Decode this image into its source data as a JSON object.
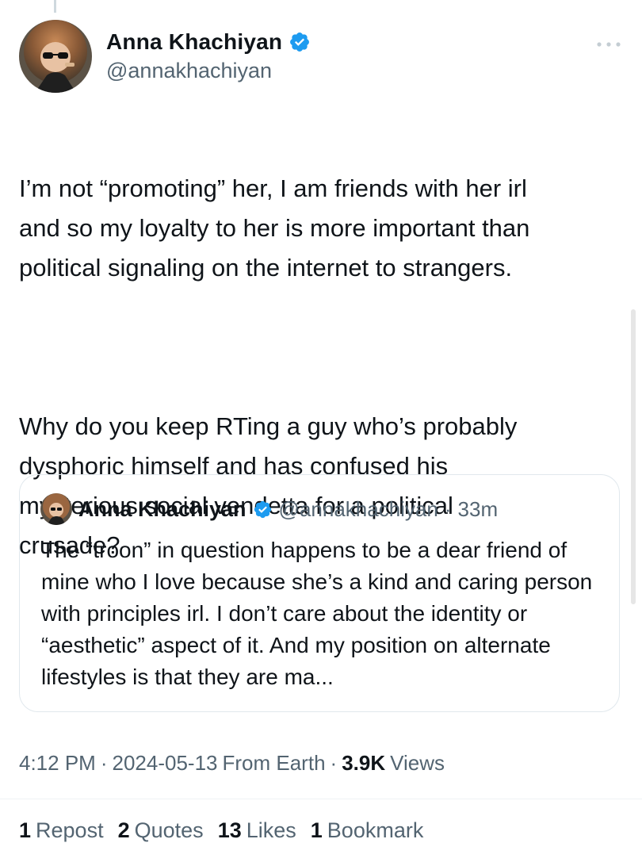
{
  "tweet": {
    "author": {
      "display_name": "Anna Khachiyan",
      "handle": "@annakhachiyan",
      "verified": true
    },
    "paragraph_1": "I’m not “promoting” her, I am friends with her irl\nand so my loyalty to her is more important than\npolitical signaling on the internet to strangers.",
    "paragraph_2": "Why do you keep RTing a guy who’s probably\ndysphoric himself and has confused his\nmysterious social vendetta for a political\ncrusade?",
    "more_icon": "more-horizontal-icon"
  },
  "quote": {
    "display_name": "Anna Khachiyan",
    "handle": "@annakhachiyan",
    "dot": "·",
    "time": "33m",
    "text": "The “troon” in question happens to be a dear friend of mine who I love because she’s a kind and caring person with principles irl. I don’t care about the identity or “aesthetic” aspect of it. And my position on alternate lifestyles is that they are ma..."
  },
  "meta": {
    "time": "4:12 PM",
    "sep1": "·",
    "date": "2024-05-13",
    "source": "From Earth",
    "sep2": "·",
    "views_count": "3.9K",
    "views_label": "Views"
  },
  "stats": {
    "reposts_count": "1",
    "reposts_label": "Repost",
    "quotes_count": "2",
    "quotes_label": "Quotes",
    "likes_count": "13",
    "likes_label": "Likes",
    "bookmarks_count": "1",
    "bookmarks_label": "Bookmark"
  },
  "colors": {
    "text_primary": "#0f1419",
    "text_secondary": "#536471",
    "verified_blue": "#1d9bf0",
    "border": "#e1e8ed"
  }
}
